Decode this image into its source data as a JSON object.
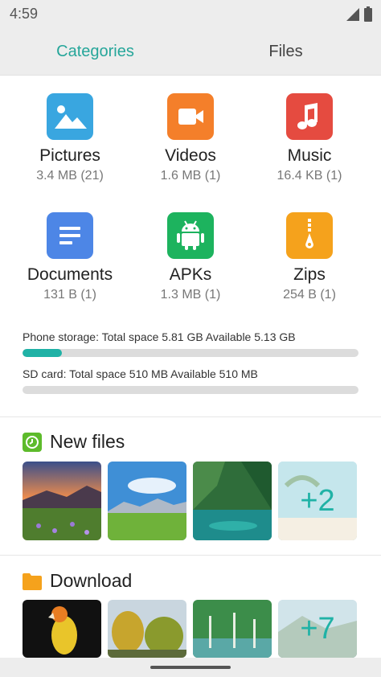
{
  "status_bar": {
    "time": "4:59"
  },
  "tabs": {
    "categories": "Categories",
    "files": "Files"
  },
  "categories": [
    {
      "name": "Pictures",
      "info": "3.4 MB (21)",
      "icon": "pictures-icon",
      "color": "#39a6e0"
    },
    {
      "name": "Videos",
      "info": "1.6 MB (1)",
      "icon": "video-camera-icon",
      "color": "#f47f2a"
    },
    {
      "name": "Music",
      "info": "16.4 KB (1)",
      "icon": "music-note-icon",
      "color": "#e54b40"
    },
    {
      "name": "Documents",
      "info": "131 B (1)",
      "icon": "document-icon",
      "color": "#4d86e6"
    },
    {
      "name": "APKs",
      "info": "1.3 MB (1)",
      "icon": "android-icon",
      "color": "#1db35e"
    },
    {
      "name": "Zips",
      "info": "254 B (1)",
      "icon": "zip-icon",
      "color": "#f5a21c"
    }
  ],
  "storage": {
    "phone_label": "Phone storage: Total space 5.81 GB  Available 5.13 GB",
    "phone_used_fraction": 0.117,
    "sd_label": "SD card: Total space 510 MB  Available 510 MB",
    "sd_used_fraction": 0.0
  },
  "new_files": {
    "title": "New files",
    "more": "+2"
  },
  "download": {
    "title": "Download",
    "more": "+7"
  },
  "colors": {
    "accent": "#26a69a",
    "bar_fill": "#20b2a6"
  }
}
